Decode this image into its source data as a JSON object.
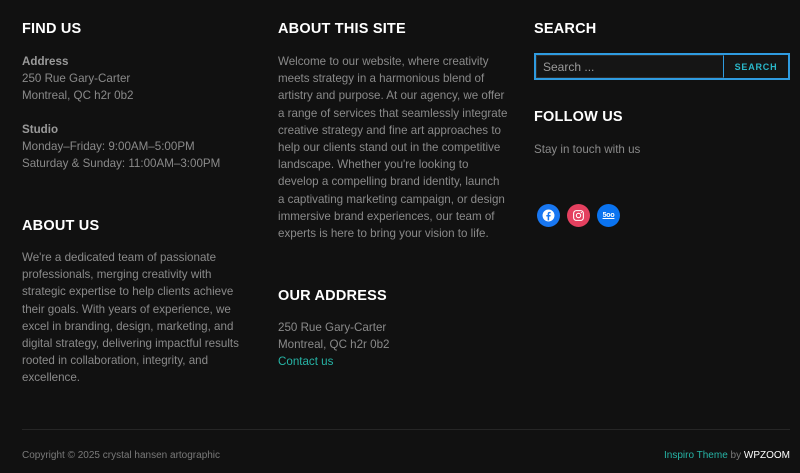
{
  "find_us": {
    "title": "FIND US",
    "address_label": "Address",
    "address_lines": [
      "250 Rue Gary-Carter",
      "Montreal, QC h2r 0b2"
    ],
    "studio_label": "Studio",
    "studio_hours": [
      "Monday–Friday: 9:00AM–5:00PM",
      "Saturday & Sunday: 11:00AM–3:00PM"
    ]
  },
  "about_us": {
    "title": "ABOUT US",
    "lines": [
      "We're a dedicated team of passionate",
      "professionals, merging creativity with",
      "strategic expertise to help clients achieve",
      "their goals. With years of experience, we",
      "excel in branding, design, marketing, and",
      "digital strategy, delivering impactful results",
      "rooted in collaboration, integrity, and",
      "excellence."
    ]
  },
  "about_site": {
    "title": "ABOUT THIS SITE",
    "lines": [
      "Welcome to our website, where creativity",
      "meets strategy in a harmonious blend of",
      "artistry and purpose. At our agency, we offer",
      "a range of services that seamlessly integrate",
      "creative strategy and fine art approaches to",
      "help our clients stand out in the competitive",
      "landscape. Whether you're looking to",
      "develop a compelling brand identity, launch",
      "a captivating marketing campaign, or design",
      "immersive brand experiences, our team of",
      "experts is here to bring your vision to life."
    ]
  },
  "our_address": {
    "title": "OUR ADDRESS",
    "lines": [
      "250 Rue Gary-Carter",
      "Montreal, QC h2r 0b2"
    ],
    "contact_link": "Contact us"
  },
  "search": {
    "title": "SEARCH",
    "placeholder": "Search ...",
    "button": "SEARCH"
  },
  "follow": {
    "title": "FOLLOW US",
    "subtitle": "Stay in touch with us",
    "networks": [
      {
        "name": "facebook",
        "glyph": "f",
        "color": "#1877f2"
      },
      {
        "name": "instagram",
        "glyph": "◎",
        "color": "#e4405f"
      },
      {
        "name": "500px",
        "glyph": "5oo",
        "color": "#0a73f0"
      }
    ]
  },
  "footer": {
    "copyright": "Copyright © 2025 crystal hansen artographic",
    "theme_link": "Inspiro Theme",
    "by": "by",
    "brand_link": "WPZOOM"
  }
}
